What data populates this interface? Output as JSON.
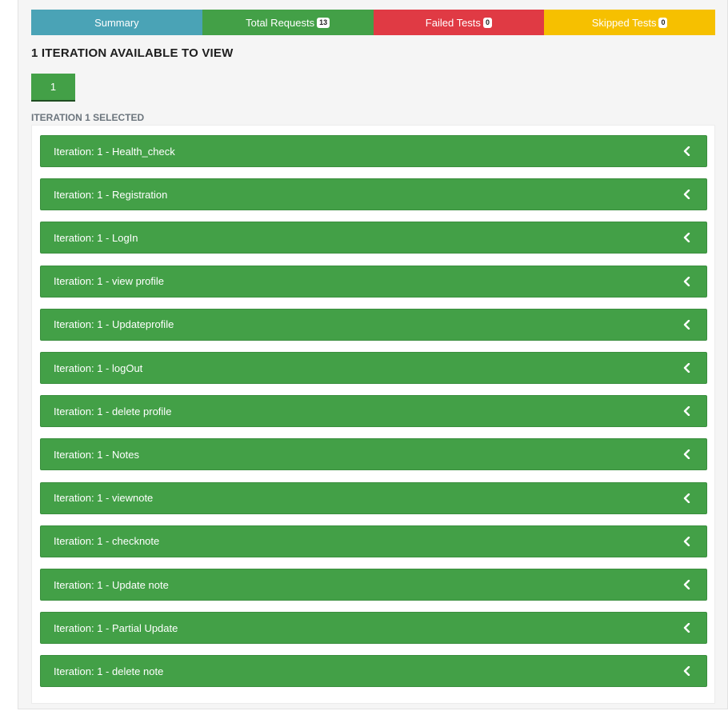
{
  "tabs": [
    {
      "label": "Summary",
      "badge": null,
      "color": "#4aa3b6"
    },
    {
      "label": "Total Requests",
      "badge": "13",
      "color": "#43a047"
    },
    {
      "label": "Failed Tests",
      "badge": "0",
      "color": "#e03a44"
    },
    {
      "label": "Skipped Tests",
      "badge": "0",
      "color": "#f6c000"
    }
  ],
  "heading": "1 ITERATION AVAILABLE TO VIEW",
  "iteration_button": "1",
  "selected_label": "ITERATION 1 SELECTED",
  "items": [
    "Iteration: 1 - Health_check",
    "Iteration: 1 - Registration",
    "Iteration: 1 - LogIn",
    "Iteration: 1 - view profile",
    "Iteration: 1 - Updateprofile",
    "Iteration: 1 - logOut",
    "Iteration: 1 - delete profile",
    "Iteration: 1 - Notes",
    "Iteration: 1 - viewnote",
    "Iteration: 1 - checknote",
    "Iteration: 1 - Update note",
    "Iteration: 1 - Partial Update",
    "Iteration: 1 - delete note"
  ],
  "icons": {
    "item_toggle": "chevron-left-icon"
  },
  "colors": {
    "item_bg": "#43a047",
    "item_text": "#ffffff"
  }
}
